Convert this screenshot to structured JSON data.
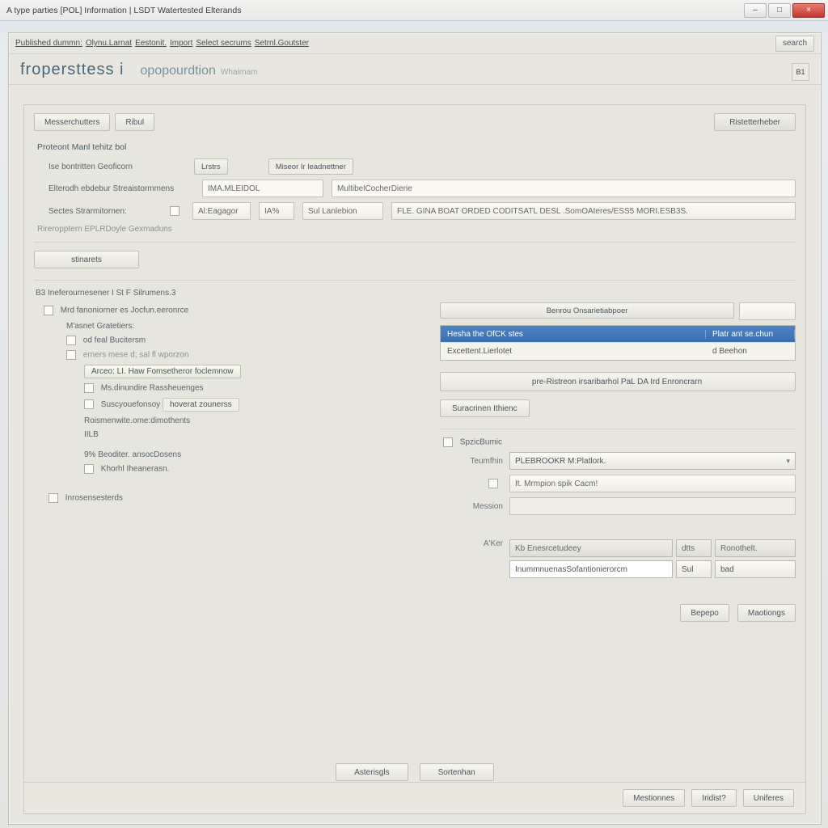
{
  "window": {
    "title": "A type parties [POL] Information | LSDT Watertested Elterands",
    "min": "–",
    "max": "□",
    "close": "×"
  },
  "menubar": {
    "items": [
      "Published dummn:",
      "Olynu.Larnat",
      "Eestonit.",
      "Import",
      "Select secrums",
      "Setrnl.Goutster"
    ],
    "right_tool": "search"
  },
  "header": {
    "main": "fropersttess i",
    "sub": "opopourdtion",
    "sub2": "Whairnam",
    "corner_btn": "B1"
  },
  "toolbar": {
    "btn1": "Messerchutters",
    "btn2": "Ribul",
    "btn_right": "Ristetterheber"
  },
  "section1": {
    "title": "Proteont Manl tehitz bol",
    "row1_label": "Ise bontritten Geoficorn",
    "row1_btn1": "Lrstrs",
    "row1_btn2": "Miseor Ir leadnettner",
    "row2_label": "Elterodh ebdebur Streaistormmens",
    "row2_field1": "IMA.MLEIDOL",
    "row2_field2": "MultibelCocherDierie",
    "row3_label": "Sectes Strarmitornen:",
    "row3_chk_label": "",
    "row3_field1": "Al:Eagagor",
    "row3_field2": "IA%",
    "row3_field3": "Sul Lanlebion",
    "row3_field4": "FLE. GINA BOAT ORDED CODITSATL DESL .SomOAteres/ESS5    MORI.ESB3S.",
    "footer": "Rireropptern   EPLRDoyle Gexmaduns"
  },
  "submit_btn": "stinarets",
  "section2": {
    "breadcrumb": "B3  Ineferournesener I St F   Silrumens.3",
    "root": "Mrd fanoniorner es Jocfun.eeronrce",
    "nodes": {
      "n1": "M'asnet Gratetiers:",
      "n2": "od feal Bucitersm",
      "n3": "erners mese d; sal fl wporzon",
      "n3_chip": "Arceo: LI. Haw Fomsetheror foclemnow",
      "n4": "Ms.dinundire Rassheuenges",
      "n5_label": "Suscyouefonsoy",
      "n5_badge": "hoverat zounerss",
      "n6": "Roismenwite.ome:dimothents",
      "n7": "IILB",
      "n8": "9% Beoditer. ansocDosens",
      "n9": "Khorhl Iheanerasn.",
      "n10": "Inrosensesterds"
    }
  },
  "rightpane": {
    "top_btn": "Benrou Onsarietiabpoer",
    "list_header_a": "Hesha the OfCK stes",
    "list_header_b": "Platr ant se.chun",
    "list_row_a": "Excettent.Lierlotet",
    "list_row_b": "d Beehon",
    "long_btn1": "pre-Ristreon irsaribarhol  PaL DA Ird Enroncrarn",
    "long_btn2": "Suracrinen Ithienc"
  },
  "lowform": {
    "sect_label": "SpzicBumic",
    "k1": "Teumfhin",
    "v1": "PLEBROOKR M:Platlork.",
    "k2": "",
    "v2": "It. Mrmpion spik Cacm!",
    "k3": "Mession",
    "v3": "",
    "gridk": "A'Ker",
    "grid_h1": "Kb Enesrcetudeey",
    "grid_h2": "dtts",
    "grid_h3": "Ronothelt.",
    "grid_r1_a": "InummnuenasSofantionierorcm",
    "grid_r1_b": "Sul",
    "grid_r1_c": "bad"
  },
  "panel_footer": {
    "b1": "Вереро",
    "b2": "Maotiongs"
  },
  "dialog_footer": {
    "b1": "Asterisgls",
    "b2": "Sortenhan"
  },
  "window_footer": {
    "b1": "Mestionnes",
    "b2": "Iridist?",
    "b3": "Uniferes"
  }
}
